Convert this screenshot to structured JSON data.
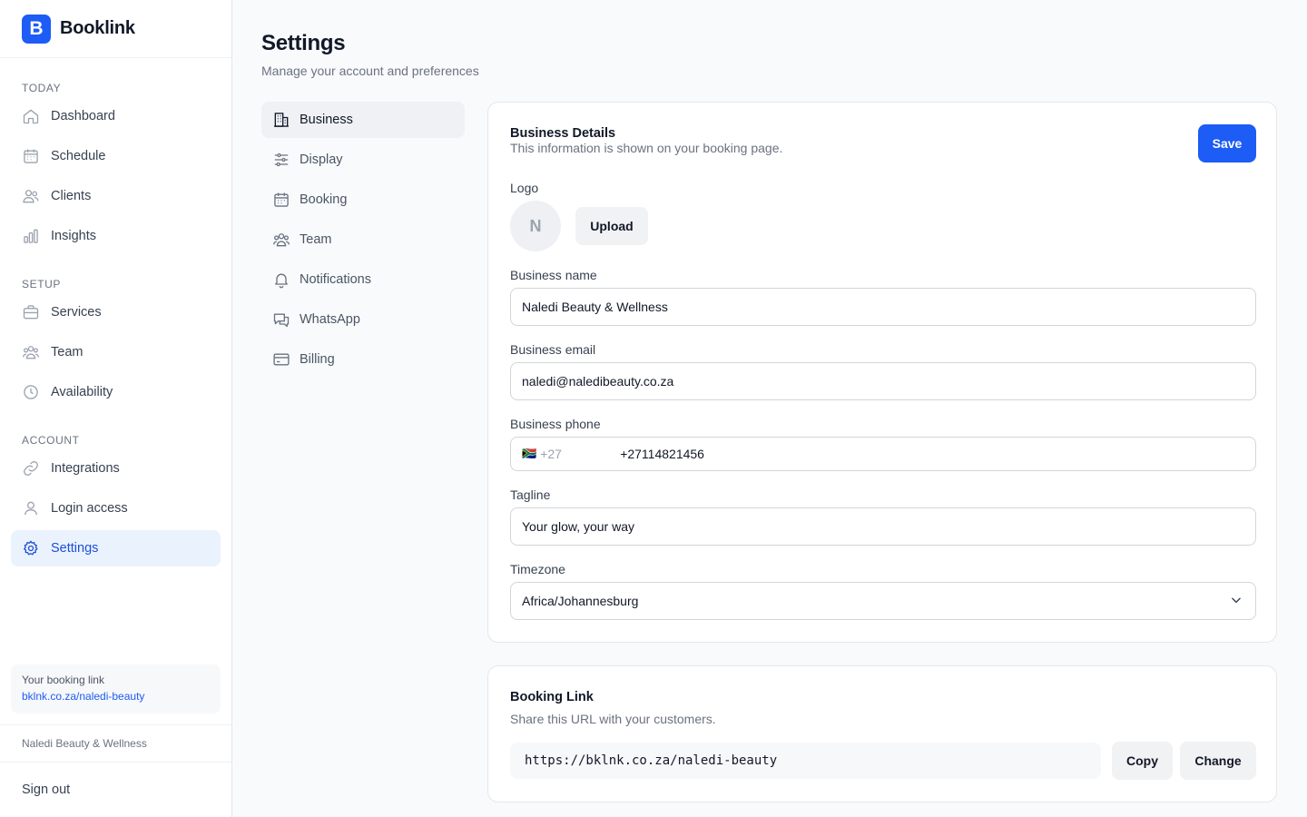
{
  "brand": {
    "logo_letter": "B",
    "name": "Booklink",
    "color": "#1d5cf5"
  },
  "sidebar": {
    "sections": [
      {
        "title": "TODAY",
        "items": [
          {
            "label": "Dashboard",
            "icon": "home-icon"
          },
          {
            "label": "Schedule",
            "icon": "calendar-icon"
          },
          {
            "label": "Clients",
            "icon": "users-icon"
          },
          {
            "label": "Insights",
            "icon": "bar-chart-icon"
          }
        ]
      },
      {
        "title": "SETUP",
        "items": [
          {
            "label": "Services",
            "icon": "briefcase-icon"
          },
          {
            "label": "Team",
            "icon": "team-icon"
          },
          {
            "label": "Availability",
            "icon": "clock-icon"
          }
        ]
      },
      {
        "title": "ACCOUNT",
        "items": [
          {
            "label": "Integrations",
            "icon": "link-icon"
          },
          {
            "label": "Login access",
            "icon": "user-icon"
          },
          {
            "label": "Settings",
            "icon": "gear-icon",
            "active": true
          }
        ]
      }
    ],
    "booking_link_label": "Your booking link",
    "booking_link": "bklnk.co.za/naledi-beauty",
    "business_name": "Naledi Beauty & Wellness",
    "sign_out": "Sign out"
  },
  "page": {
    "title": "Settings",
    "subtitle": "Manage your account and preferences"
  },
  "settings_nav": [
    {
      "label": "Business",
      "icon": "building-icon",
      "active": true
    },
    {
      "label": "Display",
      "icon": "sliders-icon"
    },
    {
      "label": "Booking",
      "icon": "calendar-icon"
    },
    {
      "label": "Team",
      "icon": "team-icon"
    },
    {
      "label": "Notifications",
      "icon": "bell-icon"
    },
    {
      "label": "WhatsApp",
      "icon": "chat-icon"
    },
    {
      "label": "Billing",
      "icon": "credit-card-icon"
    }
  ],
  "business_details": {
    "title": "Business Details",
    "description": "This information is shown on your booking page.",
    "save_label": "Save",
    "logo_label": "Logo",
    "logo_initial": "N",
    "upload_label": "Upload",
    "name_label": "Business name",
    "name_value": "Naledi Beauty & Wellness",
    "email_label": "Business email",
    "email_value": "naledi@naledibeauty.co.za",
    "phone_label": "Business phone",
    "phone_flag": "🇿🇦",
    "phone_code": "+27",
    "phone_value": "+27114821456",
    "tagline_label": "Tagline",
    "tagline_value": "Your glow, your way",
    "timezone_label": "Timezone",
    "timezone_value": "Africa/Johannesburg"
  },
  "booking_link_card": {
    "title": "Booking Link",
    "description": "Share this URL with your customers.",
    "url": "https://bklnk.co.za/naledi-beauty",
    "copy_label": "Copy",
    "change_label": "Change"
  }
}
